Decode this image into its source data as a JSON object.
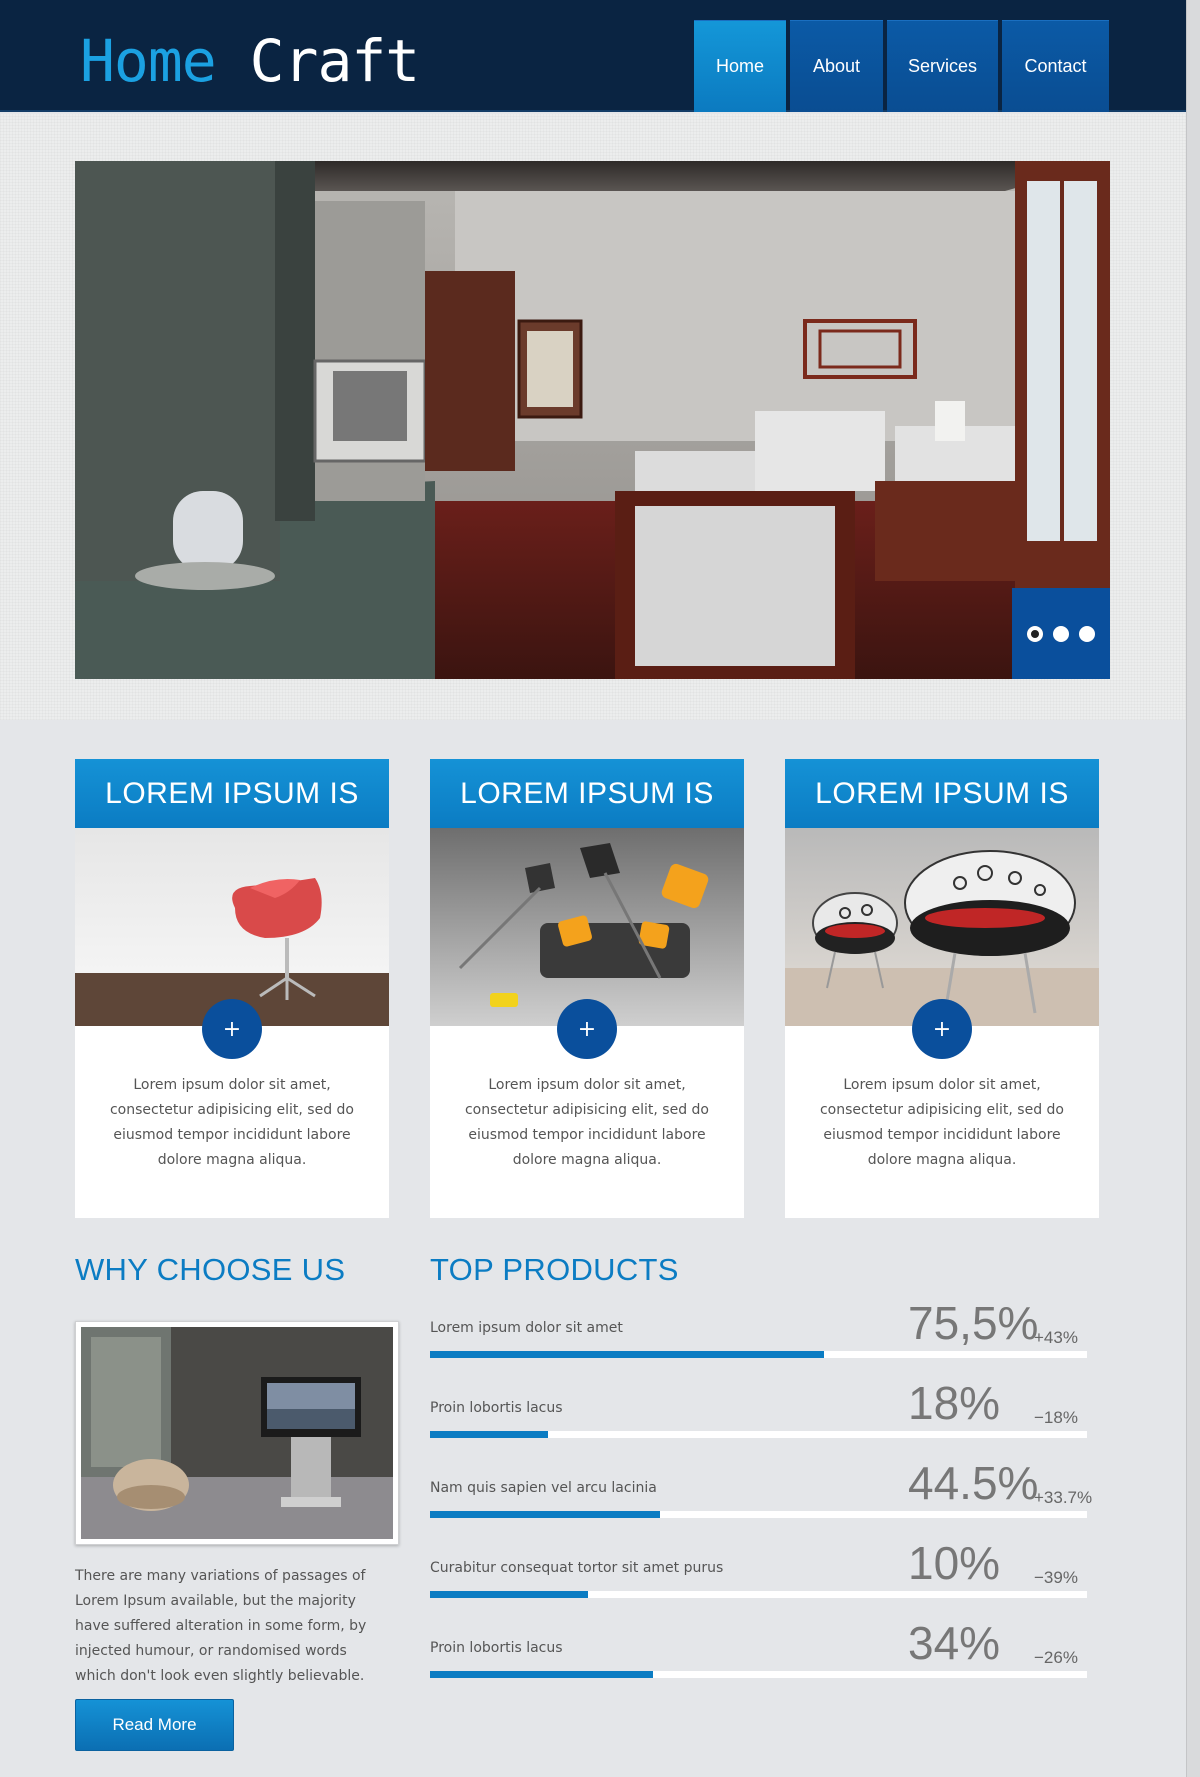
{
  "brand": {
    "part1": "Home",
    "part2": "Craft"
  },
  "nav": [
    {
      "label": "Home",
      "active": true
    },
    {
      "label": "About",
      "active": false
    },
    {
      "label": "Services",
      "active": false
    },
    {
      "label": "Contact",
      "active": false
    }
  ],
  "slider": {
    "dots": 3,
    "active_index": 0
  },
  "cards": [
    {
      "title": "LOREM IPSUM IS",
      "text": "Lorem ipsum dolor sit amet, consectetur adipisicing elit, sed do eiusmod tempor incididunt labore dolore magna aliqua.",
      "button": "+"
    },
    {
      "title": "LOREM IPSUM IS",
      "text": "Lorem ipsum dolor sit amet, consectetur adipisicing elit, sed do eiusmod tempor incididunt labore dolore magna aliqua.",
      "button": "+"
    },
    {
      "title": "LOREM IPSUM IS",
      "text": "Lorem ipsum dolor sit amet, consectetur adipisicing elit, sed do eiusmod tempor incididunt labore dolore magna aliqua.",
      "button": "+"
    }
  ],
  "why": {
    "title": "WHY CHOOSE US",
    "text": "There are many variations of passages of Lorem Ipsum available, but the majority have suffered alteration in some form, by injected humour, or randomised words which don't look even slightly believable.",
    "button": "Read More"
  },
  "products": {
    "title": "TOP PRODUCTS",
    "items": [
      {
        "label": "Lorem ipsum dolor sit amet",
        "percent": "75,5%",
        "change": "+43%",
        "fill": 0.6
      },
      {
        "label": "Proin lobortis lacus",
        "percent": "18%",
        "change": "−18%",
        "fill": 0.18
      },
      {
        "label": "Nam quis sapien vel arcu lacinia",
        "percent": "44.5%",
        "change": "+33.7%",
        "fill": 0.35
      },
      {
        "label": "Curabitur consequat tortor sit amet purus",
        "percent": "10%",
        "change": "−39%",
        "fill": 0.24
      },
      {
        "label": "Proin lobortis lacus",
        "percent": "34%",
        "change": "−26%",
        "fill": 0.34
      }
    ]
  },
  "colors": {
    "header": "#0a2442",
    "accent": "#0b7cc3",
    "dark_accent": "#0a4f9c",
    "background": "#e4e6e9"
  }
}
